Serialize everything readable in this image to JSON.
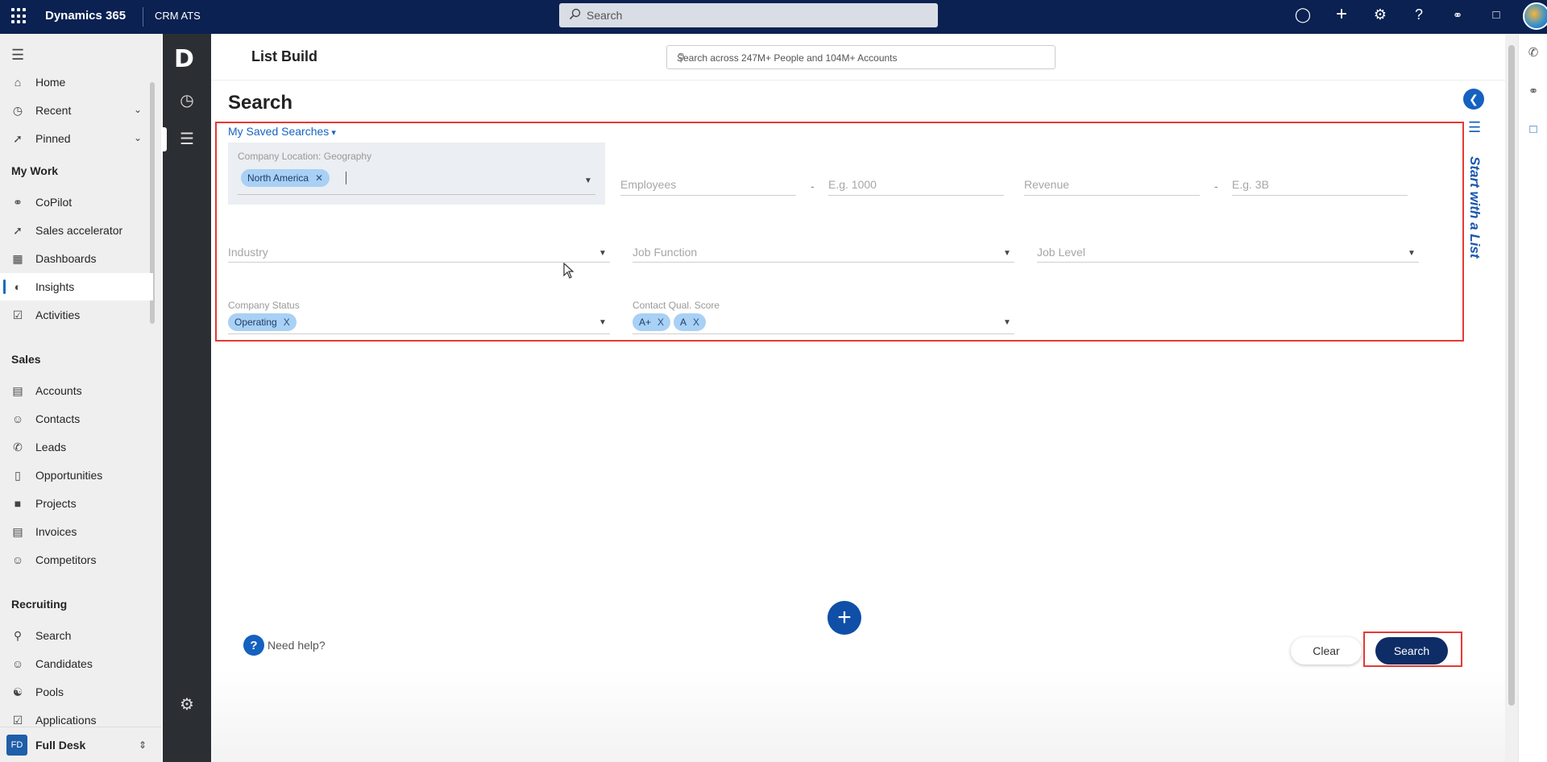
{
  "topbar": {
    "brand": "Dynamics 365",
    "app_name": "CRM ATS",
    "search_placeholder": "Search"
  },
  "leftnav": {
    "items_top": [
      {
        "label": "Home",
        "icon": "home-icon"
      },
      {
        "label": "Recent",
        "icon": "clock-icon",
        "expandable": true
      },
      {
        "label": "Pinned",
        "icon": "pin-icon",
        "expandable": true
      }
    ],
    "sections": [
      {
        "title": "My Work",
        "items": [
          {
            "label": "CoPilot",
            "icon": "copilot-icon"
          },
          {
            "label": "Sales accelerator",
            "icon": "rocket-icon"
          },
          {
            "label": "Dashboards",
            "icon": "dashboard-icon"
          },
          {
            "label": "Insights",
            "icon": "insights-icon",
            "active": true
          },
          {
            "label": "Activities",
            "icon": "clipboard-icon"
          }
        ]
      },
      {
        "title": "Sales",
        "items": [
          {
            "label": "Accounts",
            "icon": "accounts-icon"
          },
          {
            "label": "Contacts",
            "icon": "person-icon"
          },
          {
            "label": "Leads",
            "icon": "phone-person-icon"
          },
          {
            "label": "Opportunities",
            "icon": "opportunity-icon"
          },
          {
            "label": "Projects",
            "icon": "briefcase-icon"
          },
          {
            "label": "Invoices",
            "icon": "invoice-icon"
          },
          {
            "label": "Competitors",
            "icon": "person-icon"
          }
        ]
      },
      {
        "title": "Recruiting",
        "items": [
          {
            "label": "Search",
            "icon": "search-icon"
          },
          {
            "label": "Candidates",
            "icon": "person-icon"
          },
          {
            "label": "Pools",
            "icon": "group-icon"
          },
          {
            "label": "Applications",
            "icon": "checkbox-icon"
          }
        ]
      }
    ],
    "footer": {
      "badge": "FD",
      "label": "Full Desk"
    }
  },
  "app": {
    "title": "List Build",
    "people_search_placeholder": "Search across 247M+ People and 104M+ Accounts",
    "page_heading": "Search",
    "saved_searches": "My Saved Searches",
    "filters": {
      "geo_label": "Company Location: Geography",
      "geo_chip": "North America",
      "employees_placeholder": "Employees",
      "employees_max_placeholder": "E.g. 1000",
      "revenue_placeholder": "Revenue",
      "revenue_max_placeholder": "E.g. 3B",
      "industry_placeholder": "Industry",
      "job_function_placeholder": "Job Function",
      "job_level_placeholder": "Job Level",
      "company_status_label": "Company Status",
      "company_status_chip": "Operating",
      "contact_score_label": "Contact Qual. Score",
      "contact_score_chips": [
        "A+",
        "A"
      ]
    },
    "start_with_list": "Start with a List",
    "help_text": "Need help?",
    "clear_label": "Clear",
    "search_label": "Search"
  },
  "colors": {
    "topbar": "#0a2151",
    "accent": "#1561c0",
    "search_button": "#0e2d66",
    "highlight_border": "#e53935",
    "chip": "#a9d0f5"
  }
}
